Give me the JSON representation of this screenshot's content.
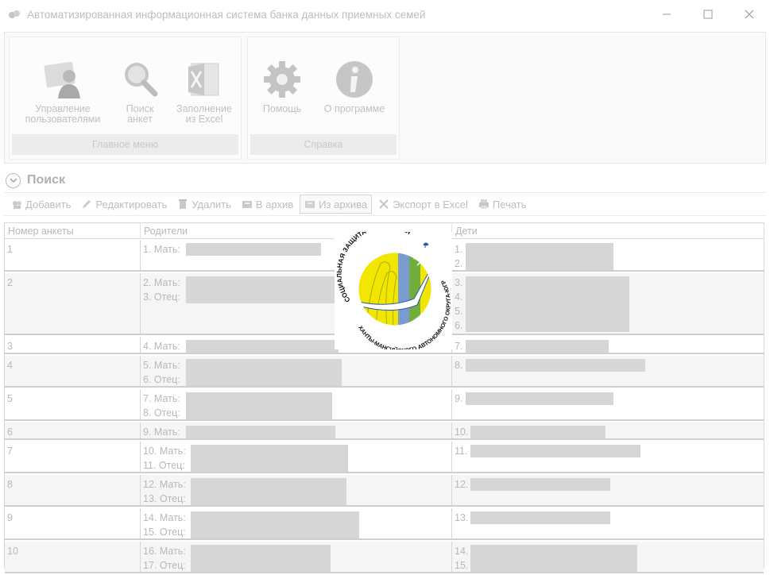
{
  "window": {
    "title": "Автоматизированная информационная система банка данных приемных семей",
    "icons": {
      "app": "app-icon",
      "minimize": "minimize-icon",
      "maximize": "maximize-icon",
      "close": "close-icon"
    }
  },
  "ribbon": {
    "groups": [
      {
        "caption": "Главное меню",
        "buttons": [
          {
            "line1": "Управление",
            "line2": "пользователями",
            "icon": "users-icon"
          },
          {
            "line1": "Поиск",
            "line2": "анкет",
            "icon": "search-icon"
          },
          {
            "line1": "Заполнение",
            "line2": "из Excel",
            "icon": "excel-icon"
          }
        ]
      },
      {
        "caption": "Справка",
        "buttons": [
          {
            "line1": "Помощь",
            "line2": "",
            "icon": "gear-icon"
          },
          {
            "line1": "О программе",
            "line2": "",
            "icon": "info-icon"
          }
        ]
      }
    ]
  },
  "search": {
    "label": "Поиск",
    "icon": "chevron-down-icon"
  },
  "toolbar": {
    "add": "Добавить",
    "edit": "Редактировать",
    "delete": "Удалить",
    "to_archive": "В архив",
    "from_archive": "Из архива",
    "export_excel": "Экспорт в Excel",
    "print": "Печать"
  },
  "table": {
    "headers": {
      "number": "Номер анкеты",
      "parents": "Родители",
      "children": "Дети"
    },
    "rows": [
      {
        "number": "1",
        "parents": [
          "1. Мать:"
        ],
        "children": [
          "1.",
          "2."
        ]
      },
      {
        "number": "2",
        "parents": [
          "2. Мать:",
          "3. Отец:"
        ],
        "children": [
          "3.",
          "4.",
          "5.",
          "6."
        ]
      },
      {
        "number": "3",
        "parents": [
          "4. Мать:"
        ],
        "children": [
          "7."
        ]
      },
      {
        "number": "4",
        "parents": [
          "5. Мать:",
          "6. Отец:"
        ],
        "children": [
          "8."
        ]
      },
      {
        "number": "5",
        "parents": [
          "7. Мать:",
          "8. Отец:"
        ],
        "children": [
          "9."
        ]
      },
      {
        "number": "6",
        "parents": [
          "9. Мать:"
        ],
        "children": [
          "10."
        ]
      },
      {
        "number": "7",
        "parents": [
          "10. Мать:",
          "11. Отец:"
        ],
        "children": [
          "11."
        ]
      },
      {
        "number": "8",
        "parents": [
          "12. Мать:",
          "13. Отец:"
        ],
        "children": [
          "12."
        ]
      },
      {
        "number": "9",
        "parents": [
          "14. Мать:",
          "15. Отец:"
        ],
        "children": [
          "13."
        ]
      },
      {
        "number": "10",
        "parents": [
          "16. Мать:",
          "17. Отец:"
        ],
        "children": [
          "14.",
          "15."
        ]
      }
    ]
  },
  "watermark": {
    "text_top": "СОЦИАЛЬНАЯ ЗАЩИТА НАСЕЛЕНИЯ",
    "text_bottom": "ХАНТЫ-МАНСИЙСКОГО АВТОНОМНОГО ОКРУГА-ЮГРЫ",
    "colors": {
      "yellow": "#f2e500",
      "green": "#6fae3c",
      "blue": "#7a9bd0"
    }
  }
}
